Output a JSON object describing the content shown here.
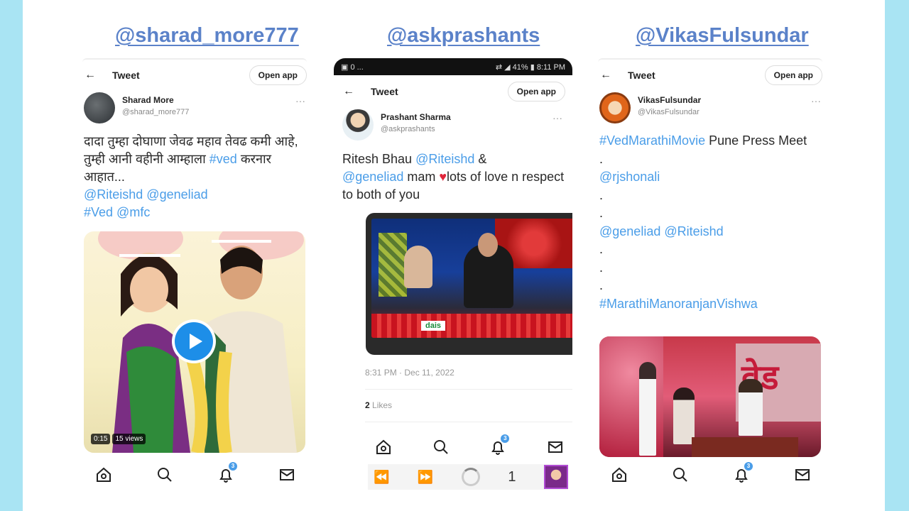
{
  "handles": [
    "@sharad_more777",
    "@askprashants",
    "@VikasFulsundar"
  ],
  "cards": [
    {
      "header_title": "Tweet",
      "open_app": "Open app",
      "name": "Sharad More",
      "handle": "@sharad_more777",
      "text_plain": "दादा तुम्हा दोघाणा जेवढ महाव तेवढ कमी आहे, तुम्ही आनी वहीनी आम्हाला ",
      "text_link1": "#ved",
      "text_plain2": " करनार आहात...",
      "mentions": "@Riteishd @geneliad",
      "tags": "#Ved @mfc",
      "video_time": "0:15",
      "video_views": "15 views"
    },
    {
      "status_left": "▣ 0 ...",
      "status_right": "⇄ ◢ 41% ▮ 8:11 PM",
      "header_title": "Tweet",
      "open_app": "Open app",
      "name": "Prashant Sharma",
      "handle": "@askprashants",
      "text_a": "Ritesh Bhau ",
      "text_mention1": "@Riteishd",
      "text_b": " &",
      "text_mention2": "@geneliad",
      "text_c": " mam ",
      "heart": "♥",
      "text_d": "lots of love n respect to both of you",
      "tv_logo": "dais",
      "timestamp": "8:31 PM · Dec 11, 2022",
      "likes_count": "2",
      "likes_label": "Likes",
      "browser_page": "1"
    },
    {
      "header_title": "Tweet",
      "open_app": "Open app",
      "name": "VikasFulsundar",
      "handle": "@VikasFulsundar",
      "line1_tag": "#VedMarathiMovie",
      "line1_text": " Pune Press Meet",
      "line2": "@rjshonali",
      "line3": "@geneliad @Riteishd",
      "line4": "#MarathiManoranjanVishwa",
      "poster_text": "वेड",
      "dot": "."
    }
  ],
  "nav_badge": "3",
  "colors": {
    "link": "#4a9de8",
    "handle": "#5b82c9",
    "bg": "#a9e4f3"
  }
}
